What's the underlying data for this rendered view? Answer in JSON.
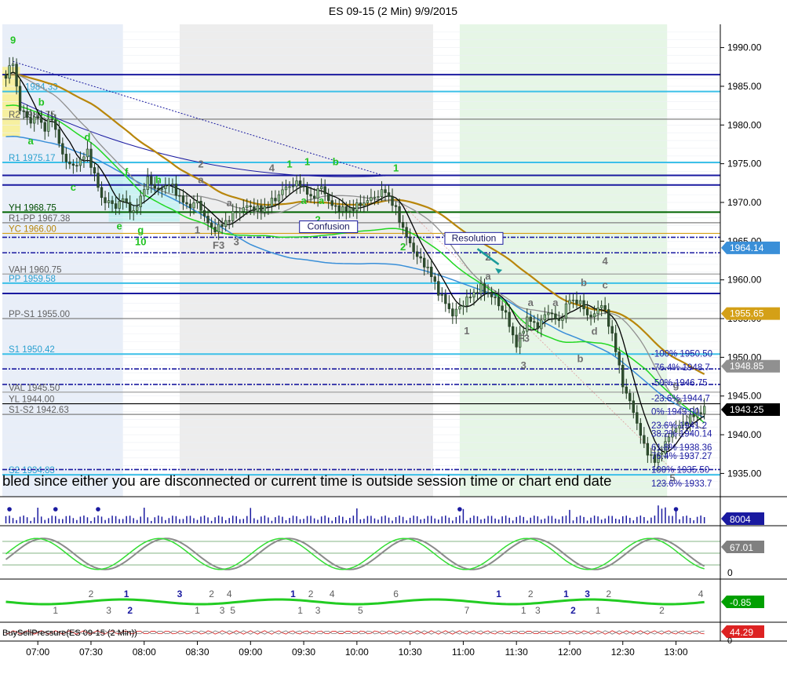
{
  "title": "ES 09-15 (2 Min)  9/9/2015",
  "banner": "bled since either you are disconnected or current time is outside session time or chart end date",
  "colors": {
    "up": "#8fbc8f",
    "down": "#2f4f2f",
    "green_label": "#22c322",
    "gray_label": "#707070",
    "blue_line": "#1a1aa0",
    "cyan_line": "#3cc0e8",
    "gold_line": "#b8860b",
    "ma_blue": "#3a8fd8",
    "ma_gray": "#909090",
    "ma_black": "#000000",
    "ma_green": "#22d822"
  },
  "chart_data": {
    "type": "candlestick",
    "symbol": "ES 09-15",
    "interval": "2 Min",
    "date": "9/9/2015",
    "ylim": [
      1932,
      1993
    ],
    "xlim": [
      "06:40",
      "13:25"
    ],
    "y_ticks": [
      "1990.00",
      "1985.00",
      "1980.00",
      "1975.00",
      "1970.00",
      "1965.00",
      "1960.00",
      "1955.00",
      "1950.00",
      "1945.00",
      "1940.00",
      "1935.00"
    ],
    "x_ticks": [
      "07:00",
      "07:30",
      "08:00",
      "08:30",
      "09:00",
      "09:30",
      "10:00",
      "10:30",
      "11:00",
      "11:30",
      "12:00",
      "12:30",
      "13:00"
    ],
    "price_anchors": [
      {
        "t": "06:42",
        "p": 1986.5
      },
      {
        "t": "06:46",
        "p": 1988.0
      },
      {
        "t": "06:50",
        "p": 1982.0
      },
      {
        "t": "06:56",
        "p": 1980.5
      },
      {
        "t": "07:00",
        "p": 1981.0
      },
      {
        "t": "07:04",
        "p": 1979.5
      },
      {
        "t": "07:08",
        "p": 1981.0
      },
      {
        "t": "07:14",
        "p": 1976.0
      },
      {
        "t": "07:20",
        "p": 1974.5
      },
      {
        "t": "07:28",
        "p": 1976.5
      },
      {
        "t": "07:36",
        "p": 1970.5
      },
      {
        "t": "07:44",
        "p": 1969.5
      },
      {
        "t": "07:48",
        "p": 1970.5
      },
      {
        "t": "07:54",
        "p": 1968.5
      },
      {
        "t": "08:02",
        "p": 1973.0
      },
      {
        "t": "08:08",
        "p": 1971.5
      },
      {
        "t": "08:14",
        "p": 1972.5
      },
      {
        "t": "08:24",
        "p": 1969.5
      },
      {
        "t": "08:30",
        "p": 1970.0
      },
      {
        "t": "08:38",
        "p": 1966.5
      },
      {
        "t": "08:44",
        "p": 1967.0
      },
      {
        "t": "08:50",
        "p": 1968.5
      },
      {
        "t": "08:58",
        "p": 1969.5
      },
      {
        "t": "09:06",
        "p": 1969.0
      },
      {
        "t": "09:14",
        "p": 1970.5
      },
      {
        "t": "09:20",
        "p": 1972.0
      },
      {
        "t": "09:28",
        "p": 1972.5
      },
      {
        "t": "09:34",
        "p": 1970.5
      },
      {
        "t": "09:40",
        "p": 1972.0
      },
      {
        "t": "09:46",
        "p": 1969.5
      },
      {
        "t": "09:54",
        "p": 1969.0
      },
      {
        "t": "10:00",
        "p": 1969.5
      },
      {
        "t": "10:08",
        "p": 1970.5
      },
      {
        "t": "10:16",
        "p": 1971.5
      },
      {
        "t": "10:22",
        "p": 1969.0
      },
      {
        "t": "10:28",
        "p": 1965.5
      },
      {
        "t": "10:34",
        "p": 1963.0
      },
      {
        "t": "10:40",
        "p": 1961.5
      },
      {
        "t": "10:46",
        "p": 1958.5
      },
      {
        "t": "10:54",
        "p": 1955.5
      },
      {
        "t": "11:02",
        "p": 1957.5
      },
      {
        "t": "11:10",
        "p": 1959.0
      },
      {
        "t": "11:18",
        "p": 1957.5
      },
      {
        "t": "11:24",
        "p": 1955.5
      },
      {
        "t": "11:30",
        "p": 1951.5
      },
      {
        "t": "11:36",
        "p": 1955.0
      },
      {
        "t": "11:42",
        "p": 1954.0
      },
      {
        "t": "11:48",
        "p": 1956.0
      },
      {
        "t": "11:54",
        "p": 1954.5
      },
      {
        "t": "12:00",
        "p": 1957.5
      },
      {
        "t": "12:06",
        "p": 1957.0
      },
      {
        "t": "12:12",
        "p": 1955.0
      },
      {
        "t": "12:18",
        "p": 1957.0
      },
      {
        "t": "12:24",
        "p": 1953.0
      },
      {
        "t": "12:30",
        "p": 1946.5
      },
      {
        "t": "12:36",
        "p": 1943.0
      },
      {
        "t": "12:42",
        "p": 1938.5
      },
      {
        "t": "12:48",
        "p": 1936.5
      },
      {
        "t": "12:52",
        "p": 1938.0
      },
      {
        "t": "12:58",
        "p": 1940.5
      },
      {
        "t": "13:04",
        "p": 1941.5
      },
      {
        "t": "13:10",
        "p": 1942.5
      },
      {
        "t": "13:16",
        "p": 1943.25
      }
    ],
    "horizontal_levels": [
      {
        "label": "",
        "value": 1986.5,
        "color": "#1a1aa0",
        "style": "solid"
      },
      {
        "label": "1984.33",
        "value": 1984.33,
        "color": "#3cc0e8",
        "style": "solid"
      },
      {
        "label": "R2 1980.75",
        "value": 1980.75,
        "color": "#808080",
        "style": "solid"
      },
      {
        "label": "R1 1975.17",
        "value": 1975.17,
        "color": "#3cc0e8",
        "style": "solid"
      },
      {
        "label": "",
        "value": 1973.5,
        "color": "#1a1aa0",
        "style": "solid"
      },
      {
        "label": "",
        "value": 1972.25,
        "color": "#1a1aa0",
        "style": "solid"
      },
      {
        "label": "YH 1968.75",
        "value": 1968.75,
        "color": "#006400",
        "style": "solid"
      },
      {
        "label": "R1-PP 1967.38",
        "value": 1967.38,
        "color": "#808080",
        "style": "solid"
      },
      {
        "label": "YC 1966.00",
        "value": 1966.0,
        "color": "#d4a017",
        "style": "solid"
      },
      {
        "label": "",
        "value": 1965.5,
        "color": "#1a1aa0",
        "style": "dashdot"
      },
      {
        "label": "",
        "value": 1963.5,
        "color": "#1a1aa0",
        "style": "dashdot"
      },
      {
        "label": "VAH 1960.75",
        "value": 1960.75,
        "color": "#a0a0a0",
        "style": "solid"
      },
      {
        "label": "PP 1959.58",
        "value": 1959.58,
        "color": "#3cc0e8",
        "style": "solid"
      },
      {
        "label": "",
        "value": 1958.25,
        "color": "#1a1aa0",
        "style": "solid"
      },
      {
        "label": "PP-S1 1955.00",
        "value": 1955.0,
        "color": "#808080",
        "style": "solid"
      },
      {
        "label": "S1 1950.42",
        "value": 1950.42,
        "color": "#3cc0e8",
        "style": "solid"
      },
      {
        "label": "",
        "value": 1948.5,
        "color": "#1a1aa0",
        "style": "dashdot"
      },
      {
        "label": "",
        "value": 1946.5,
        "color": "#1a1aa0",
        "style": "dashdot"
      },
      {
        "label": "VAL 1945.50",
        "value": 1945.5,
        "color": "#a0a0a0",
        "style": "solid"
      },
      {
        "label": "YL 1944.00",
        "value": 1944.0,
        "color": "#000000",
        "style": "solid"
      },
      {
        "label": "S1-S2 1942.63",
        "value": 1942.63,
        "color": "#808080",
        "style": "solid"
      },
      {
        "label": "S2 1934.83",
        "value": 1934.83,
        "color": "#3cc0e8",
        "style": "solid"
      },
      {
        "label": "",
        "value": 1935.5,
        "color": "#1a1aa0",
        "style": "dashdot"
      }
    ],
    "fib_levels": [
      {
        "label": "-100%  1950.50",
        "value": 1950.5
      },
      {
        "label": "-76.4%  1948.7",
        "value": 1948.7
      },
      {
        "label": "-50%  1946.75",
        "value": 1946.75
      },
      {
        "label": "-23.6%  1944.7",
        "value": 1944.7
      },
      {
        "label": "0%  1943.00",
        "value": 1943.0
      },
      {
        "label": "23.6%  1941.2",
        "value": 1941.2
      },
      {
        "label": "38.2%  1940.14",
        "value": 1940.14
      },
      {
        "label": "61.8%  1938.36",
        "value": 1938.36
      },
      {
        "label": "76.4%  1937.27",
        "value": 1937.27
      },
      {
        "label": "100%  1935.50",
        "value": 1935.5
      },
      {
        "label": "123.6%  1933.7",
        "value": 1933.7
      }
    ],
    "price_boxes": [
      {
        "label": "1964.14",
        "value": 1964.14,
        "bg": "#3a8fd8"
      },
      {
        "label": "1955.65",
        "value": 1955.65,
        "bg": "#d4a017"
      },
      {
        "label": "1948.85",
        "value": 1948.85,
        "bg": "#909090"
      },
      {
        "label": "1943.25",
        "value": 1943.25,
        "bg": "#000000"
      }
    ],
    "annotations": [
      {
        "text": "9",
        "t": "06:46",
        "p": 1990.5,
        "color": "green"
      },
      {
        "text": "b",
        "t": "07:02",
        "p": 1982.5,
        "color": "green"
      },
      {
        "text": "a",
        "t": "06:56",
        "p": 1977.5,
        "color": "green"
      },
      {
        "text": "d",
        "t": "07:28",
        "p": 1978.0,
        "color": "green"
      },
      {
        "text": "c",
        "t": "07:20",
        "p": 1971.5,
        "color": "green"
      },
      {
        "text": "f",
        "t": "07:50",
        "p": 1973.5,
        "color": "green"
      },
      {
        "text": "e",
        "t": "07:46",
        "p": 1966.5,
        "color": "green"
      },
      {
        "text": "g",
        "t": "07:58",
        "p": 1966.0,
        "color": "green"
      },
      {
        "text": "10",
        "t": "07:58",
        "p": 1964.5,
        "color": "green"
      },
      {
        "text": "h",
        "t": "08:08",
        "p": 1972.5,
        "color": "green"
      },
      {
        "text": "2",
        "t": "08:32",
        "p": 1974.5,
        "color": "gray"
      },
      {
        "text": "a",
        "t": "08:32",
        "p": 1972.5,
        "color": "gray"
      },
      {
        "text": "a",
        "t": "08:48",
        "p": 1969.5,
        "color": "gray"
      },
      {
        "text": "1",
        "t": "08:30",
        "p": 1966.0,
        "color": "gray"
      },
      {
        "text": "F3",
        "t": "08:42",
        "p": 1964.0,
        "color": "gray"
      },
      {
        "text": "3",
        "t": "08:52",
        "p": 1964.5,
        "color": "gray"
      },
      {
        "text": "4",
        "t": "09:12",
        "p": 1974.0,
        "color": "gray"
      },
      {
        "text": "1",
        "t": "09:22",
        "p": 1974.5,
        "color": "green"
      },
      {
        "text": "1",
        "t": "09:32",
        "p": 1974.8,
        "color": "green"
      },
      {
        "text": "b",
        "t": "09:48",
        "p": 1974.8,
        "color": "green"
      },
      {
        "text": "a",
        "t": "09:30",
        "p": 1969.8,
        "color": "green"
      },
      {
        "text": "a",
        "t": "09:40",
        "p": 1969.8,
        "color": "green"
      },
      {
        "text": "2",
        "t": "09:38",
        "p": 1967.3,
        "color": "green"
      },
      {
        "text": "1",
        "t": "10:22",
        "p": 1974.0,
        "color": "green"
      },
      {
        "text": "2",
        "t": "10:26",
        "p": 1963.8,
        "color": "green"
      },
      {
        "text": "2",
        "t": "11:14",
        "p": 1962.5,
        "color": "gray"
      },
      {
        "text": "a",
        "t": "11:14",
        "p": 1960.0,
        "color": "gray"
      },
      {
        "text": "1",
        "t": "11:02",
        "p": 1953.0,
        "color": "gray"
      },
      {
        "text": "a",
        "t": "11:38",
        "p": 1956.6,
        "color": "gray"
      },
      {
        "text": "F3",
        "t": "11:34",
        "p": 1952.0,
        "color": "gray"
      },
      {
        "text": "a",
        "t": "11:52",
        "p": 1956.6,
        "color": "gray"
      },
      {
        "text": "3",
        "t": "11:34",
        "p": 1948.5,
        "color": "gray"
      },
      {
        "text": "b",
        "t": "12:06",
        "p": 1949.4,
        "color": "gray"
      },
      {
        "text": "4",
        "t": "12:20",
        "p": 1962.0,
        "color": "gray"
      },
      {
        "text": "b",
        "t": "12:08",
        "p": 1959.2,
        "color": "gray"
      },
      {
        "text": "c",
        "t": "12:20",
        "p": 1958.9,
        "color": "gray"
      },
      {
        "text": "d",
        "t": "12:14",
        "p": 1952.9,
        "color": "gray"
      },
      {
        "text": "5",
        "t": "12:58",
        "p": 1934.0,
        "color": "gray"
      },
      {
        "text": "g",
        "t": "13:00",
        "p": 1946.0,
        "color": "gray"
      },
      {
        "text": "e",
        "t": "13:02",
        "p": 1943.9,
        "color": "gray"
      }
    ],
    "boxed_labels": [
      {
        "text": "Confusion",
        "t": "09:44",
        "p": 1966.5
      },
      {
        "text": "Resolution",
        "t": "11:06",
        "p": 1965.0
      }
    ],
    "shaded_regions": [
      {
        "from": "06:40",
        "to": "07:48",
        "color": "#e8eef8"
      },
      {
        "from": "08:20",
        "to": "10:43",
        "color": "#ededed"
      },
      {
        "from": "10:58",
        "to": "12:55",
        "color": "#e6f6e6"
      }
    ],
    "volume": {
      "current": "8004",
      "ylim": [
        0,
        30000
      ]
    },
    "oscillator": {
      "current": "67.01",
      "ticks": [
        "0"
      ],
      "ylim": [
        0,
        100
      ]
    },
    "wave_indicator": {
      "current": "-0.85",
      "labels": [
        {
          "text": "2",
          "t": "07:30",
          "row": "top",
          "color": "gray"
        },
        {
          "text": "1",
          "t": "07:50",
          "row": "top",
          "color": "blue"
        },
        {
          "text": "3",
          "t": "08:20",
          "row": "top",
          "color": "blue"
        },
        {
          "text": "2",
          "t": "08:38",
          "row": "top",
          "color": "gray"
        },
        {
          "text": "4",
          "t": "08:48",
          "row": "top",
          "color": "gray"
        },
        {
          "text": "1",
          "t": "09:24",
          "row": "top",
          "color": "blue"
        },
        {
          "text": "2",
          "t": "09:34",
          "row": "top",
          "color": "gray"
        },
        {
          "text": "4",
          "t": "09:46",
          "row": "top",
          "color": "gray"
        },
        {
          "text": "6",
          "t": "10:22",
          "row": "top",
          "color": "gray"
        },
        {
          "text": "1",
          "t": "11:20",
          "row": "top",
          "color": "blue"
        },
        {
          "text": "2",
          "t": "11:38",
          "row": "top",
          "color": "gray"
        },
        {
          "text": "1",
          "t": "11:58",
          "row": "top",
          "color": "blue"
        },
        {
          "text": "3",
          "t": "12:10",
          "row": "top",
          "color": "blue"
        },
        {
          "text": "2",
          "t": "12:22",
          "row": "top",
          "color": "gray"
        },
        {
          "text": "4",
          "t": "13:14",
          "row": "top",
          "color": "gray"
        },
        {
          "text": "1",
          "t": "07:10",
          "row": "bottom",
          "color": "gray"
        },
        {
          "text": "3",
          "t": "07:40",
          "row": "bottom",
          "color": "gray"
        },
        {
          "text": "2",
          "t": "07:52",
          "row": "bottom",
          "color": "blue"
        },
        {
          "text": "1",
          "t": "08:30",
          "row": "bottom",
          "color": "gray"
        },
        {
          "text": "3",
          "t": "08:44",
          "row": "bottom",
          "color": "gray"
        },
        {
          "text": "5",
          "t": "08:50",
          "row": "bottom",
          "color": "gray"
        },
        {
          "text": "1",
          "t": "09:28",
          "row": "bottom",
          "color": "gray"
        },
        {
          "text": "3",
          "t": "09:38",
          "row": "bottom",
          "color": "gray"
        },
        {
          "text": "5",
          "t": "10:02",
          "row": "bottom",
          "color": "gray"
        },
        {
          "text": "7",
          "t": "11:02",
          "row": "bottom",
          "color": "gray"
        },
        {
          "text": "1",
          "t": "11:34",
          "row": "bottom",
          "color": "gray"
        },
        {
          "text": "3",
          "t": "11:42",
          "row": "bottom",
          "color": "gray"
        },
        {
          "text": "2",
          "t": "12:02",
          "row": "bottom",
          "color": "blue"
        },
        {
          "text": "1",
          "t": "12:16",
          "row": "bottom",
          "color": "gray"
        },
        {
          "text": "2",
          "t": "12:52",
          "row": "bottom",
          "color": "gray"
        }
      ]
    },
    "pressure": {
      "label": "BuySellPressure(ES 09-15 (2 Min))",
      "current": "44.29",
      "ticks": [
        "0"
      ]
    }
  }
}
